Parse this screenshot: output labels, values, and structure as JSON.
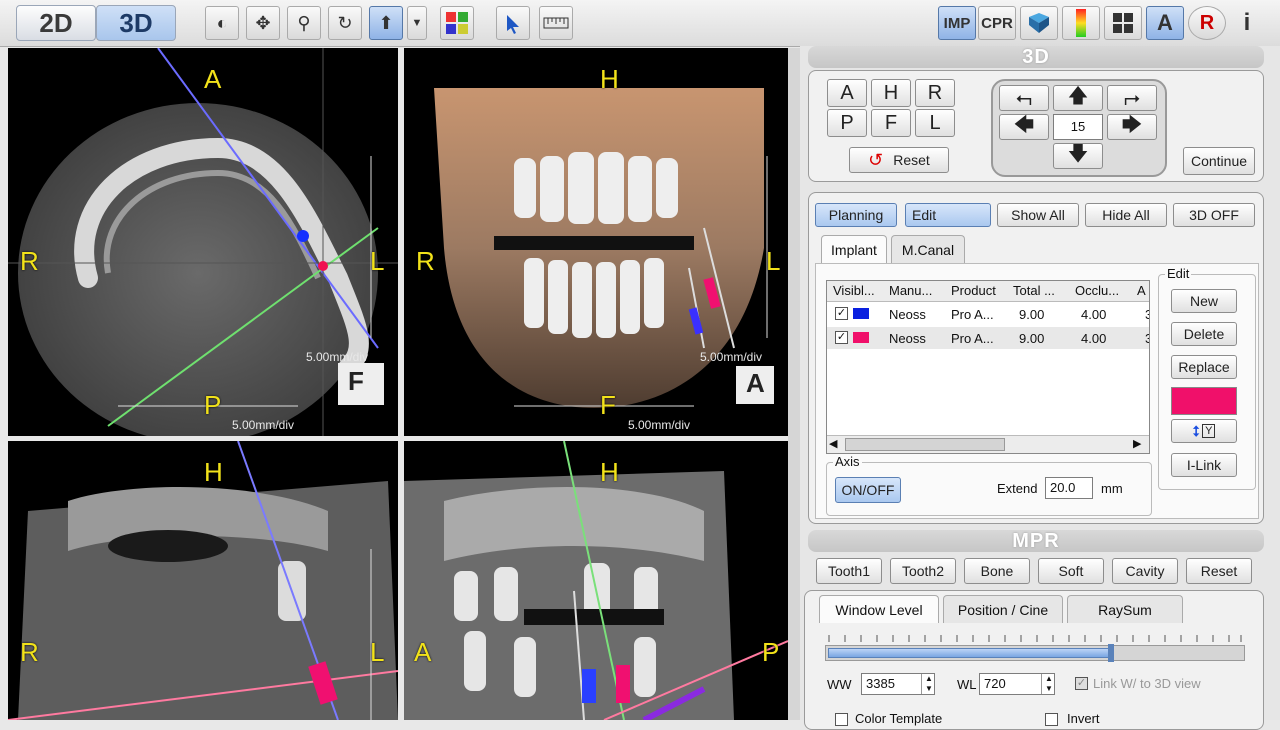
{
  "toolbar": {
    "mode_2d": "2D",
    "mode_3d": "3D",
    "right_buttons": {
      "imp": "IMP",
      "cpr": "CPR",
      "a": "A",
      "r": "R",
      "info": "i"
    }
  },
  "views": {
    "axial": {
      "top": "A",
      "left": "R",
      "right": "L",
      "bottom": "P",
      "scale_a": "5.00mm/div",
      "scale_b": "5.00mm/div",
      "cube_label": "F"
    },
    "volume": {
      "top": "H",
      "left": "R",
      "right": "L",
      "bottom": "F",
      "scale_a": "5.00mm/div",
      "scale_b": "5.00mm/div",
      "cube_label": "A"
    },
    "sagittal": {
      "top": "H",
      "left": "R",
      "right": "L"
    },
    "coronal": {
      "top": "H",
      "left": "A",
      "right": "P"
    }
  },
  "panel3d": {
    "title": "3D",
    "view_buttons": [
      "A",
      "H",
      "R",
      "P",
      "F",
      "L"
    ],
    "step_value": "15",
    "reset": "Reset",
    "continue": "Continue"
  },
  "planning": {
    "buttons": [
      "Planning",
      "Edit",
      "Show All",
      "Hide All",
      "3D OFF"
    ],
    "tabs": [
      "Implant",
      "M.Canal"
    ],
    "columns": [
      "Visibl...",
      "Manu...",
      "Product",
      "Total ...",
      "Occlu...",
      "A"
    ],
    "rows": [
      {
        "color": "#0a20e0",
        "manufacturer": "Neoss",
        "product": "Pro A...",
        "total": "9.00",
        "occlusal": "4.00",
        "extra": "3"
      },
      {
        "color": "#f0106a",
        "manufacturer": "Neoss",
        "product": "Pro A...",
        "total": "9.00",
        "occlusal": "4.00",
        "extra": "3"
      }
    ],
    "edit_group": "Edit",
    "edit_buttons": {
      "new": "New",
      "delete": "Delete",
      "replace": "Replace",
      "ilink": "I-Link"
    },
    "swatch_color": "#f0106a",
    "axis_group": "Axis",
    "axis_toggle": "ON/OFF",
    "extend_label": "Extend",
    "extend_value": "20.0",
    "extend_unit": "mm"
  },
  "mpr": {
    "title": "MPR",
    "presets": [
      "Tooth1",
      "Tooth2",
      "Bone",
      "Soft",
      "Cavity",
      "Reset"
    ],
    "tabs": [
      "Window Level",
      "Position / Cine",
      "RaySum"
    ],
    "ww_label": "WW",
    "ww_value": "3385",
    "wl_label": "WL",
    "wl_value": "720",
    "link_label": "Link W/ to 3D view",
    "color_template": "Color Template",
    "invert": "Invert"
  }
}
